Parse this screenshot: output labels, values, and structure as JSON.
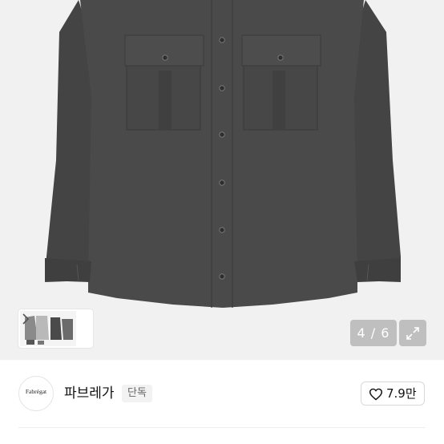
{
  "gallery": {
    "counter": "4 / 6",
    "thumbnail_icon": "product-thumbnail-stack",
    "next_icon": "chevron-right-icon",
    "expand_icon": "expand-arrows-icon",
    "shirt_color": "#4a4a4a"
  },
  "brand": {
    "logo_text": "Fabrégat",
    "name": "파브레가",
    "badge": "단독"
  },
  "like": {
    "icon": "heart-outline-icon",
    "count": "7.9만"
  }
}
